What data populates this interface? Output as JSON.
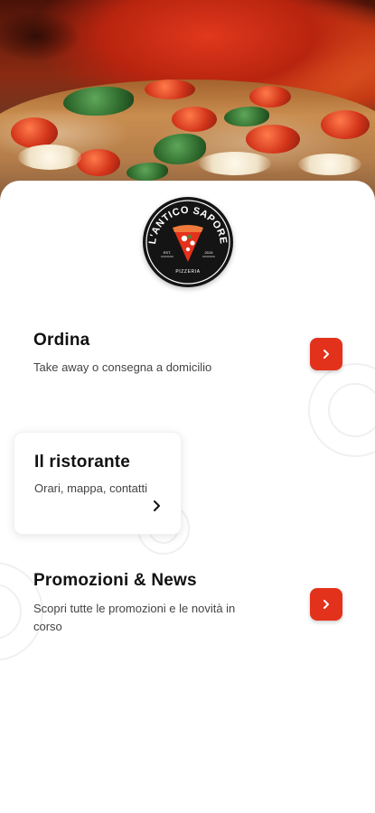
{
  "hero": {
    "image": "pizza-photo"
  },
  "logo": {
    "name_arc": "L'ANTICO SAPORE",
    "est_left": "EST.",
    "est_right": "2019",
    "subtitle": "PIZZERIA"
  },
  "menu": {
    "order": {
      "title": "Ordina",
      "subtitle": "Take away o consegna a domicilio",
      "icon": "chevron-right-icon"
    },
    "restaurant": {
      "title": "Il ristorante",
      "subtitle": "Orari, mappa, contatti",
      "icon": "chevron-right-icon"
    },
    "promotions": {
      "title": "Promozioni & News",
      "subtitle_line1": "Scopri tutte le promozioni e le novità in",
      "subtitle_line2": "corso",
      "icon": "chevron-right-icon"
    }
  },
  "colors": {
    "accent": "#e3321c",
    "background": "#ffffff",
    "logo_bg": "#141414"
  }
}
